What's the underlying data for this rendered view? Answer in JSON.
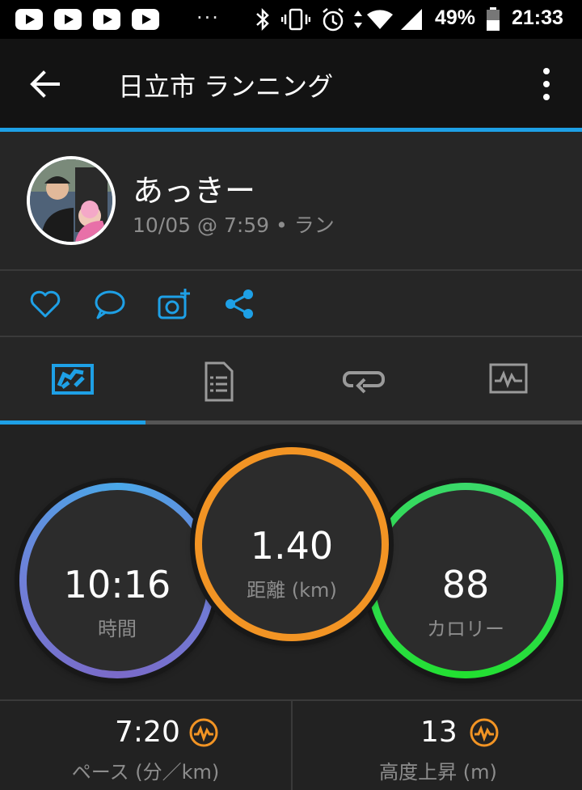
{
  "status_bar": {
    "battery": "49%",
    "time": "21:33",
    "dots": "···",
    "icons": [
      "youtube-icon",
      "youtube-icon",
      "youtube-icon",
      "youtube-icon",
      "bluetooth-icon",
      "vibrate-icon",
      "alarm-icon",
      "data-arrows-icon",
      "wifi-icon",
      "signal-icon",
      "battery-icon"
    ]
  },
  "app_bar": {
    "title": "日立市 ランニング",
    "back_icon": "arrow-left-icon",
    "menu_icon": "more-vertical-icon"
  },
  "profile": {
    "name": "あっきー",
    "meta": "10/05 @ 7:59 • ラン"
  },
  "actions": [
    "heart-icon",
    "comment-icon",
    "add-photo-icon",
    "share-icon"
  ],
  "tabs": [
    {
      "icon": "map-overview-icon",
      "active": true
    },
    {
      "icon": "details-list-icon",
      "active": false
    },
    {
      "icon": "laps-loop-icon",
      "active": false
    },
    {
      "icon": "chart-icon",
      "active": false
    }
  ],
  "stats": {
    "time": {
      "value": "10:16",
      "label": "時間"
    },
    "distance": {
      "value": "1.40",
      "label": "距離 (km)"
    },
    "calories": {
      "value": "88",
      "label": "カロリー"
    }
  },
  "metrics": {
    "pace": {
      "value": "7:20",
      "label": "ペース (分／km)"
    },
    "elevation": {
      "value": "13",
      "label": "高度上昇 (m)"
    }
  },
  "colors": {
    "accent": "#1ea0e6",
    "distance_ring": "#f29424",
    "calorie_ring": "#22e030",
    "time_ring": "#6f7fd8",
    "badge": "#f29424"
  }
}
